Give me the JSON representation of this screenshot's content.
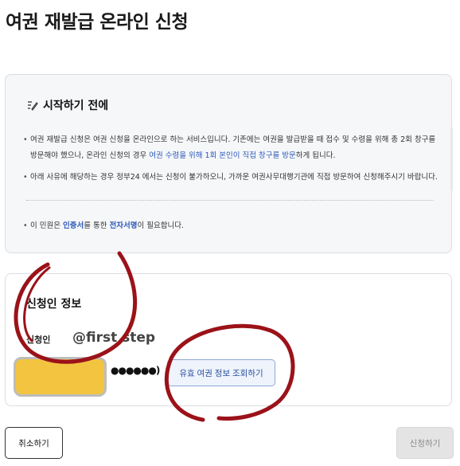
{
  "page": {
    "title": "여권 재발급 온라인 신청"
  },
  "notice": {
    "icon": "checklist-edit-icon",
    "title": "시작하기 전에",
    "bullet1_a": "여권 재발급 신청은 여권 신청을 온라인으로 하는 서비스입니다. 기존에는 여권을 발급받을 때 접수 및 수령을 위해 총 2회 창구를 방문해야 했으나, 온라인 신청의 경우 ",
    "bullet1_hl": "여권 수령을 위해 1회 본인이 직접 창구를 방문",
    "bullet1_b": "하게 됩니다.",
    "bullet2": "아래 사유에 해당하는 경우 정부24 에서는 신청이 불가하오니, 가까운 여권사무대행기관에 직접 방문하여 신청해주시기 바랍니다.",
    "bullet3_a": "이 민원은 ",
    "bullet3_cert": "인증서",
    "bullet3_b": "를 통한 ",
    "bullet3_sign": "전자서명",
    "bullet3_c": "이 필요합니다."
  },
  "applicant": {
    "title": "신청인 정보",
    "name_label": "신청인",
    "annotation": "@first step",
    "masked_id": "●●●●●●)",
    "lookup_button": "유효 여권 정보 조회하기",
    "redaction_color": "#f2c440"
  },
  "actions": {
    "cancel": "취소하기",
    "submit": "신청하기"
  },
  "colors": {
    "link_blue": "#2b59b8",
    "scribble_red": "#9b1219"
  }
}
